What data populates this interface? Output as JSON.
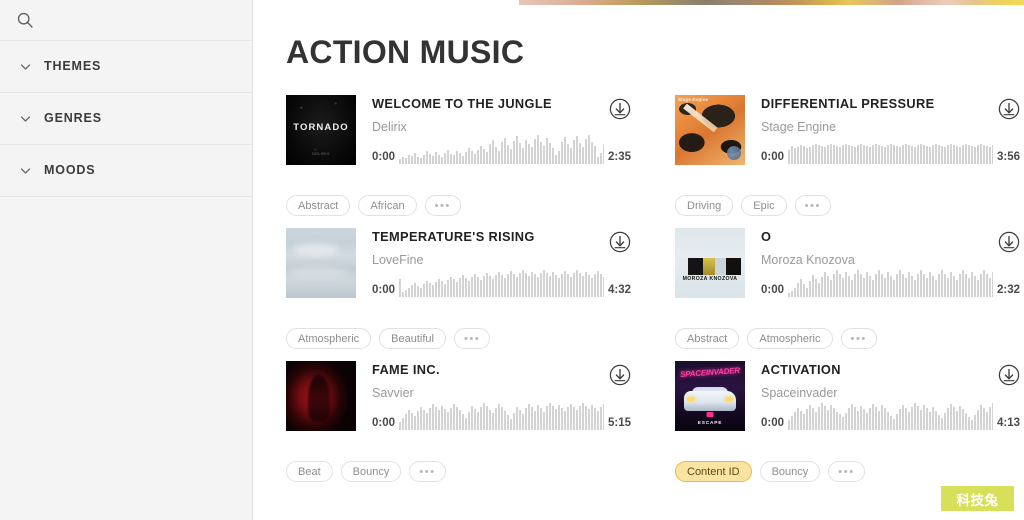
{
  "sidebar": {
    "search": {
      "icon": "search-icon",
      "placeholder": ""
    },
    "sections": [
      {
        "label": "THEMES",
        "icon": "chevron-down-icon",
        "expanded": false
      },
      {
        "label": "GENRES",
        "icon": "chevron-down-icon",
        "expanded": false
      },
      {
        "label": "MOODS",
        "icon": "chevron-down-icon",
        "expanded": false
      }
    ]
  },
  "main": {
    "page_title": "ACTION MUSIC",
    "download_icon": "download-circle-icon",
    "more_tags_label": "•••",
    "tracks": [
      {
        "title": "WELCOME TO THE JUNGLE",
        "artist": "Delirix",
        "start_time": "0:00",
        "duration": "2:35",
        "art": {
          "style": "art-tornado",
          "title_text": "TORNADO",
          "sub_text": "DELIRIX"
        },
        "tags": [
          "Abstract",
          "African"
        ],
        "highlight_tag": null
      },
      {
        "title": "DIFFERENTIAL PRESSURE",
        "artist": "Stage Engine",
        "start_time": "0:00",
        "duration": "3:56",
        "art": {
          "style": "art-stage",
          "title_text": "Stage Engine",
          "sub_text": ""
        },
        "tags": [
          "Driving",
          "Epic"
        ],
        "highlight_tag": null
      },
      {
        "title": "TEMPERATURE'S RISING",
        "artist": "LoveFine",
        "start_time": "0:00",
        "duration": "4:32",
        "art": {
          "style": "art-sky",
          "title_text": "",
          "sub_text": ""
        },
        "tags": [
          "Atmospheric",
          "Beautiful"
        ],
        "highlight_tag": null
      },
      {
        "title": "O",
        "artist": "Moroza Knozova",
        "start_time": "0:00",
        "duration": "2:32",
        "art": {
          "style": "art-moroza",
          "title_text": "MOROZA KNOZOVA",
          "sub_text": ""
        },
        "tags": [
          "Abstract",
          "Atmospheric"
        ],
        "highlight_tag": null
      },
      {
        "title": "FAME INC.",
        "artist": "Savvier",
        "start_time": "0:00",
        "duration": "5:15",
        "art": {
          "style": "art-fame",
          "title_text": "",
          "sub_text": ""
        },
        "tags": [
          "Beat",
          "Bouncy"
        ],
        "highlight_tag": null
      },
      {
        "title": "ACTIVATION",
        "artist": "Spaceinvader",
        "start_time": "0:00",
        "duration": "4:13",
        "art": {
          "style": "art-space",
          "title_text": "SPACEINVADER",
          "sub_text": "ESCAPE"
        },
        "tags": [
          "Content ID",
          "Bouncy"
        ],
        "highlight_tag": "Content ID"
      }
    ]
  },
  "watermark": {
    "text": "科技兔",
    "color": "#d8e05a"
  },
  "colors": {
    "sidebar_bg": "#f4f4f4",
    "border": "#e4e4e4",
    "title_text": "#333333",
    "artist_text": "#9a9a9a",
    "tag_border": "#e2e2e2",
    "tag_text": "#8e8e8e",
    "highlight_bg": "#fbe3a2",
    "highlight_border": "#e6b94e",
    "waveform": "#d3d3d3"
  },
  "waveforms": [
    [
      5,
      7,
      6,
      9,
      8,
      11,
      7,
      6,
      9,
      13,
      10,
      8,
      12,
      9,
      7,
      11,
      14,
      10,
      9,
      13,
      11,
      8,
      12,
      16,
      13,
      10,
      14,
      18,
      15,
      12,
      20,
      24,
      17,
      13,
      22,
      26,
      19,
      15,
      23,
      28,
      21,
      16,
      24,
      20,
      17,
      25,
      29,
      22,
      18,
      26,
      21,
      16,
      9,
      13,
      22,
      27,
      20,
      16,
      24,
      28,
      21,
      17,
      25,
      29,
      22,
      18,
      7,
      11,
      19,
      25,
      21,
      17,
      24,
      28,
      20,
      16,
      23,
      27,
      22,
      18,
      25,
      29,
      23,
      19,
      26,
      22,
      18,
      24,
      28,
      21,
      17,
      25,
      20,
      16,
      23,
      27,
      21,
      17,
      24,
      28,
      22,
      18,
      25,
      29,
      23,
      19,
      26,
      22,
      18,
      24,
      28,
      21,
      17,
      25,
      29,
      23,
      19,
      26,
      22,
      18,
      12,
      9,
      7,
      10
    ],
    [
      14,
      18,
      16,
      17,
      19,
      18,
      16,
      17,
      19,
      20,
      19,
      18,
      17,
      19,
      20,
      19,
      18,
      17,
      19,
      20,
      19,
      18,
      17,
      19,
      20,
      19,
      18,
      17,
      19,
      20,
      19,
      18,
      17,
      19,
      20,
      19,
      18,
      17,
      19,
      20,
      19,
      18,
      17,
      19,
      20,
      19,
      18,
      17,
      19,
      20,
      19,
      18,
      17,
      19,
      20,
      19,
      18,
      17,
      19,
      20,
      19,
      18,
      17,
      19,
      20,
      19,
      18,
      17,
      19,
      20,
      19,
      18,
      17,
      19,
      20,
      19,
      18,
      17,
      19,
      20,
      19,
      18,
      17,
      19,
      20,
      19,
      18,
      17,
      19,
      20,
      19,
      18,
      17,
      19,
      20,
      19,
      18,
      17,
      19,
      20,
      19,
      18,
      17,
      19,
      20,
      19,
      18,
      17,
      19,
      20,
      19,
      18,
      17,
      19,
      22,
      24,
      22,
      20,
      18,
      16,
      14,
      12
    ],
    [
      18,
      5,
      7,
      9,
      12,
      14,
      11,
      9,
      13,
      16,
      14,
      12,
      15,
      18,
      16,
      13,
      17,
      20,
      18,
      15,
      19,
      22,
      19,
      16,
      20,
      23,
      20,
      17,
      21,
      24,
      21,
      18,
      22,
      25,
      22,
      19,
      23,
      26,
      23,
      20,
      24,
      27,
      24,
      21,
      25,
      23,
      20,
      24,
      27,
      24,
      21,
      25,
      22,
      19,
      23,
      26,
      23,
      20,
      24,
      27,
      24,
      21,
      25,
      22,
      19,
      23,
      26,
      23,
      20,
      24,
      27,
      24,
      21,
      25,
      22,
      19,
      23,
      26,
      23,
      20,
      24,
      27,
      24,
      21,
      25,
      22,
      19,
      23,
      26,
      23,
      20,
      24,
      27,
      24,
      21,
      25,
      22,
      19,
      23,
      26,
      23,
      20,
      24,
      27,
      24,
      21,
      25,
      22,
      19,
      23,
      26,
      23,
      20,
      24,
      21,
      18,
      16,
      13,
      11,
      9,
      7,
      6,
      5
    ],
    [
      4,
      6,
      9,
      14,
      18,
      13,
      9,
      16,
      22,
      18,
      14,
      20,
      25,
      21,
      17,
      23,
      27,
      23,
      19,
      25,
      21,
      17,
      23,
      27,
      23,
      19,
      25,
      21,
      17,
      23,
      27,
      23,
      19,
      25,
      21,
      17,
      23,
      27,
      23,
      19,
      25,
      21,
      17,
      23,
      27,
      23,
      19,
      25,
      21,
      17,
      23,
      27,
      23,
      19,
      25,
      21,
      17,
      23,
      27,
      23,
      19,
      25,
      21,
      17,
      23,
      27,
      23,
      19,
      25,
      21,
      17,
      23,
      27,
      23,
      19,
      25,
      21,
      17,
      23,
      27,
      23,
      19,
      25,
      21,
      17,
      23,
      27,
      23,
      19,
      25,
      21,
      17,
      23,
      27,
      23,
      19,
      25,
      21,
      17,
      23,
      27,
      23,
      19,
      25,
      21,
      17,
      23,
      27,
      23,
      19,
      25,
      21,
      17,
      23,
      20,
      17,
      14,
      11,
      9,
      7,
      6
    ],
    [
      8,
      12,
      16,
      20,
      17,
      14,
      19,
      23,
      20,
      17,
      22,
      26,
      23,
      20,
      24,
      21,
      18,
      22,
      26,
      23,
      20,
      16,
      12,
      18,
      24,
      21,
      18,
      23,
      27,
      24,
      20,
      17,
      22,
      26,
      23,
      19,
      15,
      11,
      17,
      23,
      20,
      16,
      22,
      26,
      23,
      19,
      25,
      22,
      18,
      24,
      27,
      24,
      21,
      25,
      22,
      19,
      23,
      26,
      23,
      20,
      24,
      27,
      24,
      21,
      25,
      22,
      19,
      23,
      26,
      23,
      20,
      24,
      27,
      24,
      21,
      25,
      22,
      19,
      23,
      26,
      23,
      20,
      24,
      27,
      24,
      21,
      25,
      22,
      19,
      23,
      26,
      23,
      20,
      24,
      27,
      24,
      21,
      25,
      22,
      19,
      23,
      26,
      23,
      20,
      24,
      27,
      24,
      21,
      25,
      22,
      19,
      23,
      26,
      23,
      20,
      24,
      27,
      24,
      21,
      25
    ],
    [
      10,
      14,
      18,
      22,
      19,
      16,
      21,
      25,
      22,
      18,
      23,
      27,
      24,
      20,
      25,
      22,
      18,
      16,
      13,
      17,
      22,
      26,
      23,
      19,
      24,
      21,
      17,
      22,
      26,
      23,
      19,
      25,
      22,
      18,
      14,
      11,
      16,
      21,
      25,
      22,
      18,
      23,
      27,
      24,
      20,
      25,
      22,
      18,
      23,
      19,
      15,
      12,
      17,
      22,
      26,
      23,
      19,
      24,
      21,
      17,
      13,
      10,
      15,
      20,
      25,
      22,
      18,
      23,
      27,
      24,
      20,
      25,
      22,
      18,
      23,
      27,
      24,
      20,
      16,
      13,
      18,
      23,
      27,
      24,
      20,
      25,
      22,
      18,
      23,
      27,
      24,
      20,
      25,
      22,
      18,
      23,
      27,
      24,
      20,
      16,
      12,
      9,
      14,
      19,
      24,
      21,
      17,
      22,
      26,
      23,
      19,
      24,
      21,
      17,
      13,
      10,
      8,
      6
    ]
  ]
}
